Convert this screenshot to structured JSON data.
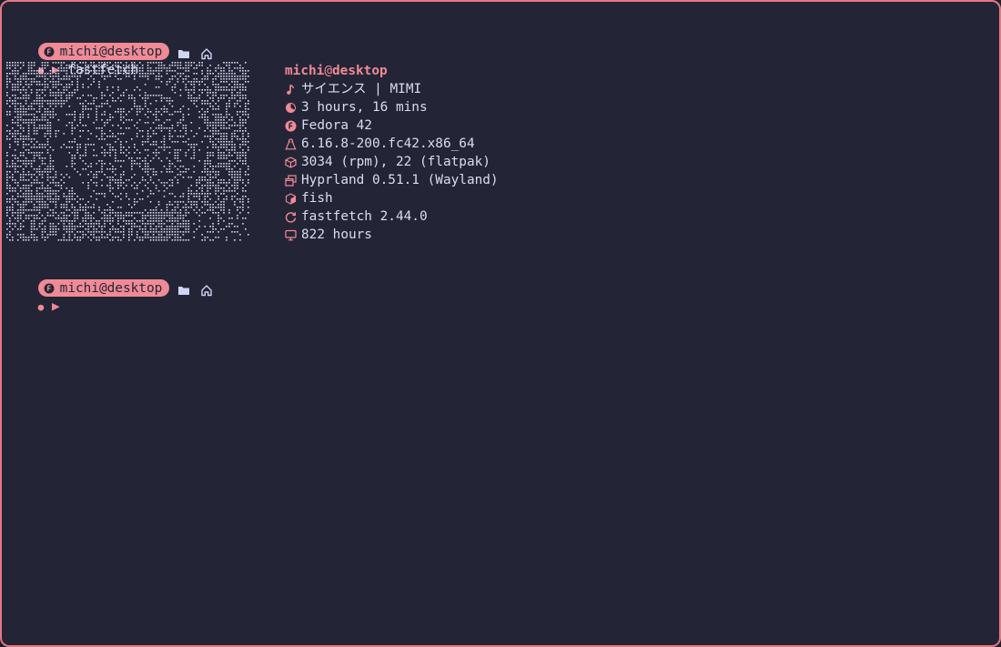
{
  "prompt": {
    "user_host": "michi@desktop",
    "symbols": {
      "dot": "●",
      "arrow": "▶"
    }
  },
  "history": {
    "command": "fastfetch"
  },
  "fastfetch": {
    "user": "michi",
    "at": "@",
    "host": "desktop",
    "rows": [
      {
        "icon": "music-note-icon",
        "text": "サイエンス | MIMI"
      },
      {
        "icon": "uptime-icon",
        "text": "3 hours, 16 mins"
      },
      {
        "icon": "fedora-icon",
        "text": "Fedora 42"
      },
      {
        "icon": "linux-tux-icon",
        "text": "6.16.8-200.fc42.x86_64"
      },
      {
        "icon": "package-box-icon",
        "text": "3034 (rpm), 22 (flatpak)"
      },
      {
        "icon": "windows-stack-icon",
        "text": "Hyprland 0.51.1 (Wayland)"
      },
      {
        "icon": "shell-cube-icon",
        "text": "fish"
      },
      {
        "icon": "refresh-icon",
        "text": "fastfetch 2.44.0"
      },
      {
        "icon": "monitor-icon",
        "text": "822 hours"
      }
    ]
  },
  "colors": {
    "background": "#232537",
    "border": "#e3797f",
    "accent": "#f08a94",
    "text": "#d9dcf0"
  }
}
